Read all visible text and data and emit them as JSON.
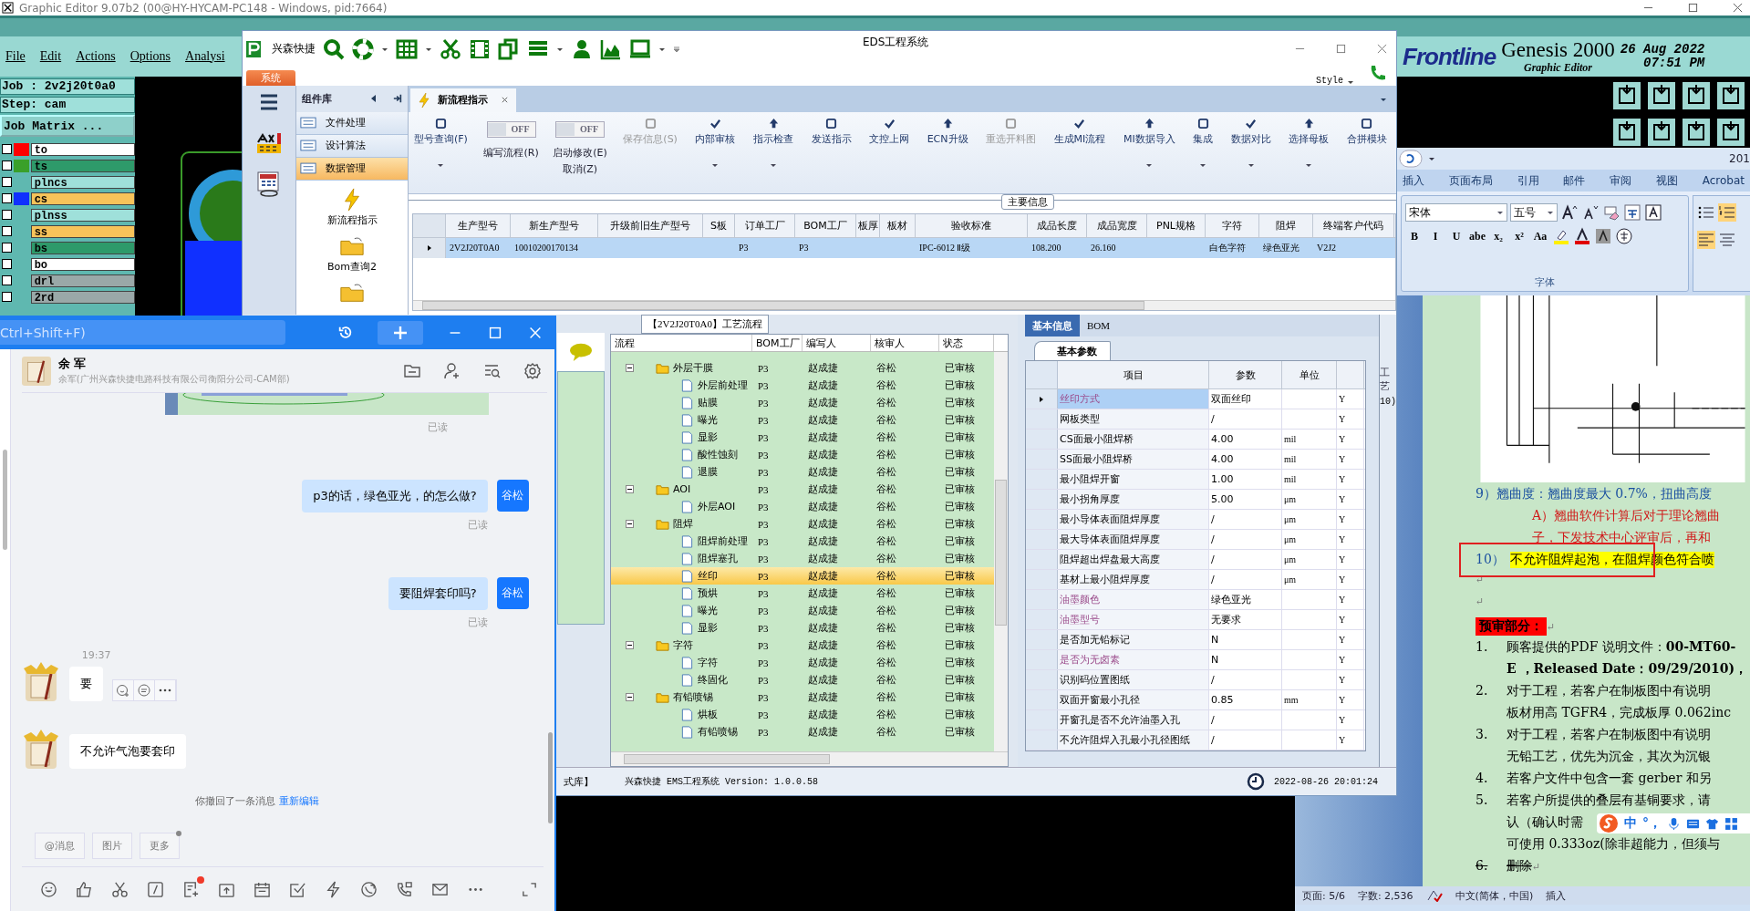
{
  "genesis": {
    "title": "Graphic Editor 9.07b2 (00@HY-HYCAM-PC148 - Windows, pid:7664)",
    "menu": [
      "File",
      "Edit",
      "Actions",
      "Options",
      "Analysi"
    ],
    "job": "Job : 2v2j20t0a0",
    "step": "Step: cam",
    "job_matrix": "Job Matrix ...",
    "layers": [
      {
        "name": "to",
        "color": "#ffffff",
        "swatch": {
          "color": "#ff0000"
        },
        "checked": false
      },
      {
        "name": "ts",
        "color": "#2e9a6a",
        "swatch": {
          "color": "#3aa02a"
        },
        "checked": false
      },
      {
        "name": "plncs",
        "color": "#9fe0da",
        "checked": false
      },
      {
        "name": "cs",
        "color": "#f7c35a",
        "swatch": {
          "color": "#1030ff"
        },
        "checked": false
      },
      {
        "name": "plnss",
        "color": "#9fe0da",
        "checked": false
      },
      {
        "name": "ss",
        "color": "#f7c35a",
        "checked": false
      },
      {
        "name": "bs",
        "color": "#2e9a6a",
        "checked": false
      },
      {
        "name": "bo",
        "color": "#ffffff",
        "checked": false
      },
      {
        "name": "drl",
        "color": "#9aa8a8",
        "checked": false
      },
      {
        "name": "2rd",
        "color": "#9aa8a8",
        "checked": false
      }
    ],
    "brand": "Frontline",
    "product": "Genesis 2000",
    "subtitle": "Graphic Editor",
    "date": "26 Aug 2022",
    "time": "07:51 PM"
  },
  "eds": {
    "title": "EDS工程系统",
    "app_name": "兴森快捷",
    "style": "Style",
    "system_tab": "系统",
    "library": {
      "title": "组件库",
      "items": [
        {
          "label": "文件处理",
          "selected": false
        },
        {
          "label": "设计算法",
          "selected": false
        },
        {
          "label": "数据管理",
          "selected": true
        }
      ],
      "tools": [
        "新流程指示",
        "Bom查询2"
      ]
    },
    "tabs": [
      {
        "label": "新流程指示",
        "selected": true
      }
    ],
    "ribbon": [
      {
        "kind": "button",
        "label": "型号查询(F)",
        "dropdown": true,
        "disabled": false
      },
      {
        "kind": "toggle",
        "label": "编写流程(R)",
        "text": "OFF",
        "on": false
      },
      {
        "kind": "toggle",
        "label": "启动修改(E)",
        "sublabel": "取消(Z)",
        "text": "OFF",
        "on": false
      },
      {
        "kind": "button",
        "label": "保存信息(S)",
        "dropdown": false,
        "disabled": true
      },
      {
        "kind": "button",
        "label": "内部审核",
        "dropdown": true,
        "disabled": false
      },
      {
        "kind": "button",
        "label": "指示检查",
        "dropdown": true,
        "disabled": false
      },
      {
        "kind": "button",
        "label": "发送指示",
        "dropdown": false,
        "disabled": false
      },
      {
        "kind": "button",
        "label": "文控上网",
        "dropdown": false,
        "disabled": false
      },
      {
        "kind": "button",
        "label": "ECN升级",
        "dropdown": false,
        "disabled": false
      },
      {
        "kind": "button",
        "label": "重选开料图",
        "dropdown": false,
        "disabled": true
      },
      {
        "kind": "button",
        "label": "生成MI流程",
        "dropdown": false,
        "disabled": false
      },
      {
        "kind": "button",
        "label": "MI数据导入",
        "dropdown": true,
        "disabled": false
      },
      {
        "kind": "button",
        "label": "集成",
        "dropdown": true,
        "disabled": false
      },
      {
        "kind": "button",
        "label": "数据对比",
        "dropdown": true,
        "disabled": false
      },
      {
        "kind": "button",
        "label": "选择母板",
        "dropdown": true,
        "disabled": false
      },
      {
        "kind": "button",
        "label": "合拼模块",
        "dropdown": false,
        "disabled": false
      }
    ],
    "group_label": "主要信息",
    "table": {
      "columns": [
        "生产型号",
        "新生产型号",
        "升级前旧生产型号",
        "S板",
        "订单工厂",
        "BOM工厂",
        "板厚",
        "板材",
        "验收标准",
        "成品长度",
        "成品宽度",
        "PNL规格",
        "字符",
        "阻焊",
        "终端客户代码"
      ],
      "rows": [
        {
          "selected": true,
          "cells": [
            "2V2J20T0A0",
            "10010200170134",
            null,
            null,
            "P3",
            "P3",
            null,
            null,
            "IPC-6012 Ⅱ级",
            "108.200",
            "26.160",
            null,
            "白色字符",
            "绿色亚光",
            "V2J2"
          ]
        }
      ]
    },
    "process": {
      "title": "【2V2J20T0A0】工艺流程",
      "columns": [
        "流程",
        "BOM工厂",
        "编写人",
        "核审人",
        "状态"
      ],
      "tree": [
        {
          "name": "外层干膜",
          "kind": "folder",
          "expanded": true,
          "selected": false,
          "factory": "P3",
          "writer": "赵成捷",
          "reviewer": "谷松",
          "status": "已审核",
          "children": [
            {
              "name": "外层前处理",
              "kind": "step",
              "selected": false,
              "factory": "P3",
              "writer": "赵成捷",
              "reviewer": "谷松",
              "status": "已审核"
            },
            {
              "name": "贴膜",
              "kind": "step",
              "selected": false,
              "factory": "P3",
              "writer": "赵成捷",
              "reviewer": "谷松",
              "status": "已审核"
            },
            {
              "name": "曝光",
              "kind": "step",
              "selected": false,
              "factory": "P3",
              "writer": "赵成捷",
              "reviewer": "谷松",
              "status": "已审核"
            },
            {
              "name": "显影",
              "kind": "step",
              "selected": false,
              "factory": "P3",
              "writer": "赵成捷",
              "reviewer": "谷松",
              "status": "已审核"
            },
            {
              "name": "酸性蚀刻",
              "kind": "step",
              "selected": false,
              "factory": "P3",
              "writer": "赵成捷",
              "reviewer": "谷松",
              "status": "已审核"
            },
            {
              "name": "退膜",
              "kind": "step",
              "selected": false,
              "factory": "P3",
              "writer": "赵成捷",
              "reviewer": "谷松",
              "status": "已审核"
            }
          ]
        },
        {
          "name": "AOI",
          "kind": "folder",
          "expanded": true,
          "selected": false,
          "factory": "P3",
          "writer": "赵成捷",
          "reviewer": "谷松",
          "status": "已审核",
          "children": [
            {
              "name": "外层AOI",
              "kind": "step",
              "selected": false,
              "factory": "P3",
              "writer": "赵成捷",
              "reviewer": "谷松",
              "status": "已审核"
            }
          ]
        },
        {
          "name": "阻焊",
          "kind": "folder",
          "expanded": true,
          "selected": false,
          "factory": "P3",
          "writer": "赵成捷",
          "reviewer": "谷松",
          "status": "已审核",
          "children": [
            {
              "name": "阻焊前处理",
              "kind": "step",
              "selected": false,
              "factory": "P3",
              "writer": "赵成捷",
              "reviewer": "谷松",
              "status": "已审核"
            },
            {
              "name": "阻焊塞孔",
              "kind": "step",
              "selected": false,
              "factory": "P3",
              "writer": "赵成捷",
              "reviewer": "谷松",
              "status": "已审核"
            },
            {
              "name": "丝印",
              "kind": "step",
              "selected": true,
              "factory": "P3",
              "writer": "赵成捷",
              "reviewer": "谷松",
              "status": "已审核"
            },
            {
              "name": "预烘",
              "kind": "step",
              "selected": false,
              "factory": "P3",
              "writer": "赵成捷",
              "reviewer": "谷松",
              "status": "已审核"
            },
            {
              "name": "曝光",
              "kind": "step",
              "selected": false,
              "factory": "P3",
              "writer": "赵成捷",
              "reviewer": "谷松",
              "status": "已审核"
            },
            {
              "name": "显影",
              "kind": "step",
              "selected": false,
              "factory": "P3",
              "writer": "赵成捷",
              "reviewer": "谷松",
              "status": "已审核"
            }
          ]
        },
        {
          "name": "字符",
          "kind": "folder",
          "expanded": true,
          "selected": false,
          "factory": "P3",
          "writer": "赵成捷",
          "reviewer": "谷松",
          "status": "已审核",
          "children": [
            {
              "name": "字符",
              "kind": "step",
              "selected": false,
              "factory": "P3",
              "writer": "赵成捷",
              "reviewer": "谷松",
              "status": "已审核"
            },
            {
              "name": "终固化",
              "kind": "step",
              "selected": false,
              "factory": "P3",
              "writer": "赵成捷",
              "reviewer": "谷松",
              "status": "已审核"
            }
          ]
        },
        {
          "name": "有铅喷锡",
          "kind": "folder",
          "expanded": true,
          "selected": false,
          "factory": "P3",
          "writer": "赵成捷",
          "reviewer": "谷松",
          "status": "已审核",
          "children": [
            {
              "name": "烘板",
              "kind": "step",
              "selected": false,
              "factory": "P3",
              "writer": "赵成捷",
              "reviewer": "谷松",
              "status": "已审核"
            },
            {
              "name": "有铅喷锡",
              "kind": "step",
              "selected": false,
              "factory": "P3",
              "writer": "赵成捷",
              "reviewer": "谷松",
              "status": "已审核"
            }
          ]
        }
      ]
    },
    "info": {
      "tabs": [
        {
          "label": "基本信息",
          "selected": true
        },
        {
          "label": "BOM",
          "selected": false
        }
      ],
      "subtab": "基本参数",
      "columns": [
        "项目",
        "参数",
        "单位"
      ],
      "rows": [
        {
          "item": "丝印方式",
          "value": "双面丝印",
          "flag": "Y",
          "emphasized": true,
          "selected": true
        },
        {
          "item": "网板类型",
          "value": "/",
          "flag": "Y",
          "emphasized": false,
          "selected": false
        },
        {
          "item": "CS面最小阻焊桥",
          "value": "4.00",
          "unit": "mil",
          "flag": "Y",
          "emphasized": false,
          "selected": false
        },
        {
          "item": "SS面最小阻焊桥",
          "value": "4.00",
          "unit": "mil",
          "flag": "Y",
          "emphasized": false,
          "selected": false
        },
        {
          "item": "最小阻焊开窗",
          "value": "1.00",
          "unit": "mil",
          "flag": "Y",
          "emphasized": false,
          "selected": false
        },
        {
          "item": "最小拐角厚度",
          "value": "5.00",
          "unit": "μm",
          "flag": "Y",
          "emphasized": false,
          "selected": false
        },
        {
          "item": "最小导体表面阻焊厚度",
          "value": "/",
          "unit": "μm",
          "flag": "Y",
          "emphasized": false,
          "selected": false
        },
        {
          "item": "最大导体表面阻焊厚度",
          "value": "/",
          "unit": "μm",
          "flag": "Y",
          "emphasized": false,
          "selected": false
        },
        {
          "item": "阻焊超出焊盘最大高度",
          "value": "/",
          "unit": "μm",
          "flag": "Y",
          "emphasized": false,
          "selected": false
        },
        {
          "item": "基材上最小阻焊厚度",
          "value": "/",
          "unit": "μm",
          "flag": "Y",
          "emphasized": false,
          "selected": false
        },
        {
          "item": "油墨颜色",
          "value": "绿色亚光",
          "flag": "Y",
          "emphasized": true,
          "selected": false
        },
        {
          "item": "油墨型号",
          "value": "无要求",
          "flag": "Y",
          "emphasized": true,
          "selected": false
        },
        {
          "item": "是否加无铅标记",
          "value": "N",
          "flag": "Y",
          "emphasized": false,
          "selected": false
        },
        {
          "item": "是否为无卤素",
          "value": "N",
          "flag": "Y",
          "emphasized": true,
          "selected": false
        },
        {
          "item": "识别码位置图纸",
          "value": "/",
          "flag": "Y",
          "emphasized": false,
          "selected": false
        },
        {
          "item": "双面开窗最小孔径",
          "value": "0.85",
          "unit": "mm",
          "flag": "Y",
          "emphasized": false,
          "selected": false
        },
        {
          "item": "开窗孔是否不允许油墨入孔",
          "value": "/",
          "flag": "Y",
          "emphasized": false,
          "selected": false
        },
        {
          "item": "不允许阻焊入孔最小孔径图纸",
          "value": "/",
          "flag": "Y",
          "emphasized": false,
          "selected": false
        }
      ]
    },
    "side_tab": "工艺",
    "side_text": "10)",
    "status": {
      "left": "式库】",
      "version": "兴森快捷  EMS工程系统 Version: 1.0.0.58",
      "datetime": "2022-08-26 20:01:24"
    }
  },
  "chat": {
    "search": "Ctrl+Shift+F)",
    "contact": {
      "name": "余 军",
      "subtitle": "余军(广州兴森快捷电路科技有限公司衡阳分公司-CAM部)"
    },
    "messages": [
      {
        "receipt": "已读"
      },
      {
        "kind": "sent",
        "text": "p3的话，绿色亚光，的怎么做?",
        "sender": "谷松",
        "receipt": "已读"
      },
      {
        "kind": "sent",
        "text": "要阻焊套印吗?",
        "sender": "谷松",
        "receipt": "已读"
      },
      {
        "kind": "received",
        "time": "19:37",
        "text": "要",
        "actions": true
      },
      {
        "kind": "received",
        "text": "不允许气泡要套印",
        "actions": false
      },
      {
        "kind": "notice",
        "text": "你撤回了一条消息",
        "link": "重新编辑"
      }
    ],
    "quick": [
      {
        "label": "@消息",
        "dot": false
      },
      {
        "label": "图片",
        "dot": false
      },
      {
        "label": "更多",
        "dot": true
      }
    ],
    "draft_badge": true
  },
  "word": {
    "title": "201",
    "tabs": [
      "插入",
      "页面布局",
      "引用",
      "邮件",
      "审阅",
      "视图",
      "Acrobat"
    ],
    "font": "宋体",
    "size": "五号",
    "format_buttons": [
      "B",
      "I",
      "U",
      "abe",
      "x₂",
      "x²",
      "Aa"
    ],
    "group": "字体",
    "lines": [
      {
        "kind": "blue",
        "text": "9）翘曲度：翘曲度最大 0.7%，扭曲高度"
      },
      {
        "kind": "red",
        "text": "A）翘曲软件计算后对于理论翘曲"
      },
      {
        "kind": "red",
        "text": "子，下发技术中心评审后，再和"
      },
      {
        "kind": "boxed",
        "number": "10）",
        "text": "不允许阻焊起泡，在阻焊颜色符合喷"
      },
      {
        "kind": "mark",
        "text": "↵"
      },
      {
        "kind": "mark",
        "text": "↵"
      },
      {
        "kind": "heading",
        "text": "预审部分：",
        "mark": "↵"
      },
      {
        "kind": "item",
        "number": "1.",
        "text": "顾客提供的PDF 说明文件：**00-MT60-**"
      },
      {
        "kind": "cont",
        "text": "**E ，Released Date：09/29/2010)，**"
      },
      {
        "kind": "item",
        "number": "2.",
        "text": "对于工程，若客户在制板图中有说明"
      },
      {
        "kind": "cont",
        "text": "板材用高 TGFR4，完成板厚 0.062inc"
      },
      {
        "kind": "item",
        "number": "3.",
        "text": "对于工程，若客户在制板图中有说明"
      },
      {
        "kind": "cont",
        "text": "无铅工艺，优先为沉金，其次为沉银"
      },
      {
        "kind": "item",
        "number": "4.",
        "text": "若客户文件中包含一套 gerber 和另"
      },
      {
        "kind": "item",
        "number": "5.",
        "text": "若客户所提供的叠层有基铜要求，请"
      },
      {
        "kind": "cont",
        "text": "认（确认时需"
      },
      {
        "kind": "cont",
        "text": "可使用 0.333oz(除非超能力，但须与"
      },
      {
        "kind": "struck",
        "number": "6.",
        "text": "删除",
        "mark": "↵"
      }
    ],
    "ime": [
      "中",
      "°，"
    ],
    "status": {
      "page": "页面: 5/6",
      "words": "字数: 2,536",
      "lang": "中文(简体，中国)",
      "mode": "插入"
    }
  }
}
